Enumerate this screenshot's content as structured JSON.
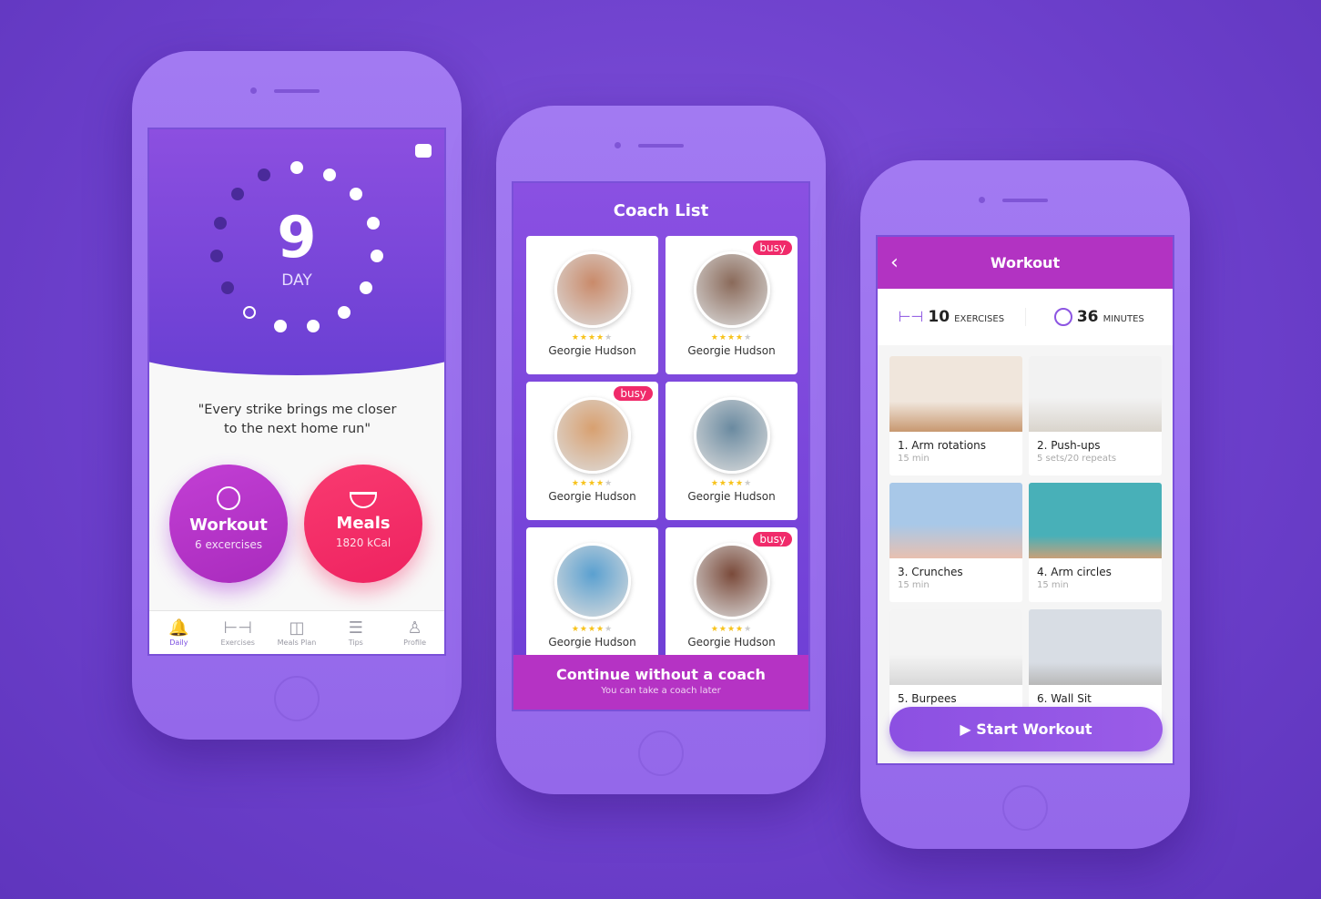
{
  "daily": {
    "day_number": "9",
    "day_label": "DAY",
    "quote": "\"Every strike brings me closer to the next home run\"",
    "workout": {
      "title": "Workout",
      "subtitle": "6 excercises"
    },
    "meals": {
      "title": "Meals",
      "subtitle": "1820 kCal"
    },
    "tabs": [
      {
        "label": "Daily",
        "icon": "bell-icon"
      },
      {
        "label": "Exercises",
        "icon": "dumbbell-icon"
      },
      {
        "label": "Meals Plan",
        "icon": "scale-icon"
      },
      {
        "label": "Tips",
        "icon": "document-icon"
      },
      {
        "label": "Profile",
        "icon": "user-icon"
      }
    ]
  },
  "coaches": {
    "title": "Coach List",
    "items": [
      {
        "name": "Georgie Hudson",
        "rating": 4,
        "busy": ""
      },
      {
        "name": "Georgie Hudson",
        "rating": 4,
        "busy": "busy"
      },
      {
        "name": "Georgie Hudson",
        "rating": 4,
        "busy": "busy"
      },
      {
        "name": "Georgie Hudson",
        "rating": 4,
        "busy": ""
      },
      {
        "name": "Georgie Hudson",
        "rating": 4,
        "busy": ""
      },
      {
        "name": "Georgie Hudson",
        "rating": 4,
        "busy": "busy"
      }
    ],
    "continue_label": "Continue without a coach",
    "continue_sub": "You can take a coach later"
  },
  "workout": {
    "title": "Workout",
    "exercises_count": "10",
    "exercises_label": "EXERCISES",
    "minutes_count": "36",
    "minutes_label": "MINUTES",
    "items": [
      {
        "name": "1. Arm rotations",
        "meta": "15 min"
      },
      {
        "name": "2. Push-ups",
        "meta": "5 sets/20 repeats"
      },
      {
        "name": "3. Crunches",
        "meta": "15 min"
      },
      {
        "name": "4. Arm circles",
        "meta": "15 min"
      },
      {
        "name": "5. Burpees",
        "meta": ""
      },
      {
        "name": "6. Wall Sit",
        "meta": ""
      }
    ],
    "start_label": "Start Workout"
  },
  "colors": {
    "purple": "#7b4fe0",
    "magenta": "#b533c4",
    "pink": "#f5306a",
    "busy": "#f02a6a"
  }
}
